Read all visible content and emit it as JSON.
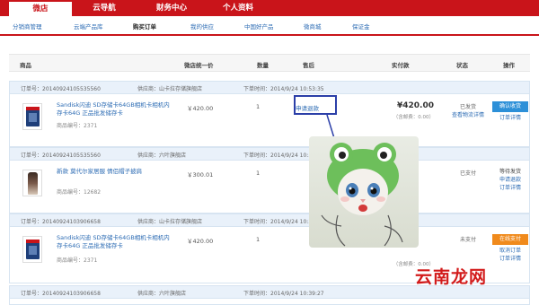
{
  "topnav": {
    "tabs": [
      {
        "label": "微店",
        "active": true
      },
      {
        "label": "云导航",
        "active": false
      },
      {
        "label": "财务中心",
        "active": false
      },
      {
        "label": "个人资料",
        "active": false
      }
    ]
  },
  "subnav": {
    "items": [
      {
        "label": "分销商管理",
        "active": false
      },
      {
        "label": "云端产品库",
        "active": false
      },
      {
        "label": "购买订单",
        "active": true
      },
      {
        "label": "我的供应",
        "active": false
      },
      {
        "label": "中国好产品",
        "active": false
      },
      {
        "label": "微商城",
        "active": false
      },
      {
        "label": "保证金",
        "active": false
      }
    ]
  },
  "table_headers": {
    "product": "商品",
    "unit_price": "微店统一价",
    "quantity": "数量",
    "after_sale": "售后",
    "paid": "实付款",
    "status": "状态",
    "operation": "操作"
  },
  "orders": [
    {
      "order_no": "订单号：20140924105535560",
      "supplier": "供应商：山卡拉存储旗舰店",
      "order_time": "下单时间：2014/9/24 10:53:35",
      "product_name": "Sandisk闪迪 SD存储卡64GB相机卡相机内存卡64G 正品批发储存卡",
      "product_code": "商品编号：2371",
      "price": "￥420.00",
      "quantity": "1",
      "after_sale": "申请退款",
      "paid_amount": "¥420.00",
      "shipping": "（含邮费：0.00）",
      "status_1": "已发货",
      "status_2": "查看物流详情",
      "op_button": "确认收货",
      "op_link": "订单详情"
    },
    {
      "order_no": "订单号：20140924105535560",
      "supplier": "供应商：六叶旗舰店",
      "order_time": "下单时间：2014/9/24 10:53:35",
      "product_name": "新款 莫代尔家居服 情侣帽子披肩",
      "product_code": "商品编号：12682",
      "price": "￥300.01",
      "quantity": "1",
      "after_sale": "",
      "paid_amount": "",
      "shipping": "",
      "status_1": "已支付",
      "status_2": "",
      "op_button": "等待发货",
      "op_link": "申请退款",
      "op_link2": "订单详情"
    },
    {
      "order_no": "订单号：20140924103906658",
      "supplier": "供应商：山卡拉存储旗舰店",
      "order_time": "下单时间：2014/9/24 10:39:27",
      "product_name": "Sandisk闪迪 SD存储卡64GB相机卡相机内存卡64G 正品批发储存卡",
      "product_code": "商品编号：2371",
      "price": "￥420.00",
      "quantity": "1",
      "after_sale": "",
      "paid_amount": "",
      "shipping": "（含邮费：0.00）",
      "status_1": "未支付",
      "status_2": "",
      "op_button": "在线支付",
      "op_link": "取消订单",
      "op_link2": "订单详情"
    },
    {
      "order_no": "订单号：20140924103906658",
      "supplier": "供应商：六叶旗舰店",
      "order_time": "下单时间：2014/9/24 10:39:27"
    }
  ],
  "watermark": "云南龙网",
  "colors": {
    "brand_red": "#c9141a",
    "link_blue": "#2d6cb4",
    "button_blue": "#2d90d8",
    "button_orange": "#f08a1c",
    "highlight_box": "#2b3fa8"
  }
}
